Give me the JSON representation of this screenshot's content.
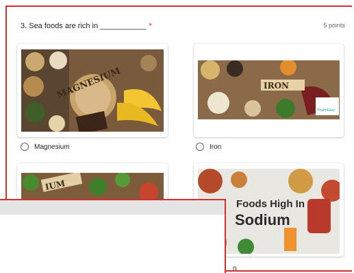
{
  "question": {
    "number_title": "3. Sea foods are rich in ___________",
    "required_mark": "*",
    "points": "5 points"
  },
  "options": [
    {
      "label": "Magnesium",
      "image_text": "MAGNESIUM"
    },
    {
      "label": "Iron",
      "image_text": "IRON",
      "image_logo_text": "PharmEasy"
    },
    {
      "label": "",
      "image_text": "IUM"
    },
    {
      "label": "n",
      "image_title_line1": "Foods High In",
      "image_title_line2": "Sodium"
    }
  ]
}
